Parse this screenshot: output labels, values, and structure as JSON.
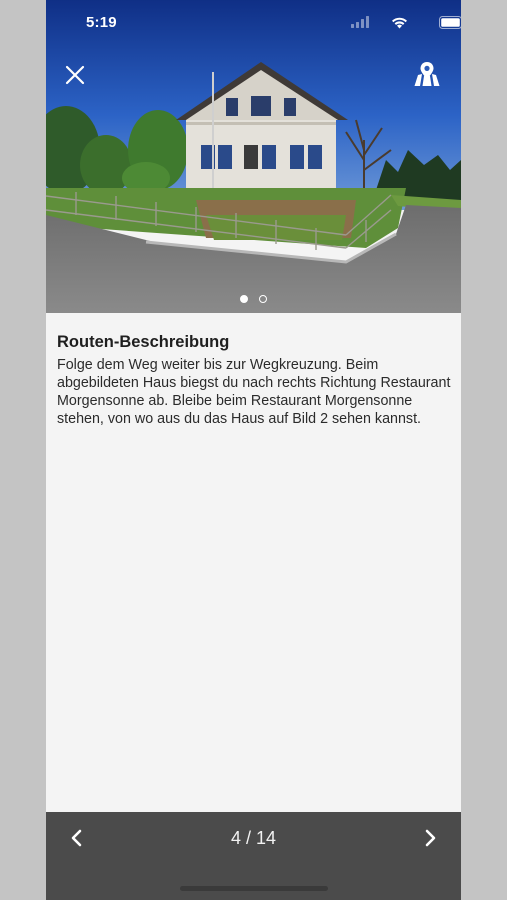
{
  "status_bar": {
    "time": "5:19"
  },
  "header": {
    "close_icon": "close-icon",
    "map_icon": "map-pin-icon",
    "image_count": 2,
    "active_image": 1
  },
  "description": {
    "title": "Routen-Beschreibung",
    "text": "Folge dem Weg weiter bis zur Wegkreuzung. Beim abgebildeten Haus biegst du nach rechts Richtung Restaurant Morgensonne ab. Bleibe beim Restaurant Morgensonne stehen, von wo aus du das Haus auf Bild 2 sehen kannst."
  },
  "navigation": {
    "prev_icon": "chevron-left-icon",
    "next_icon": "chevron-right-icon",
    "page_indicator": "4 / 14"
  },
  "colors": {
    "bottom_bar": "#4b4b4b",
    "content_bg": "#f4f4f4",
    "outer_bg": "#c4c4c4"
  }
}
